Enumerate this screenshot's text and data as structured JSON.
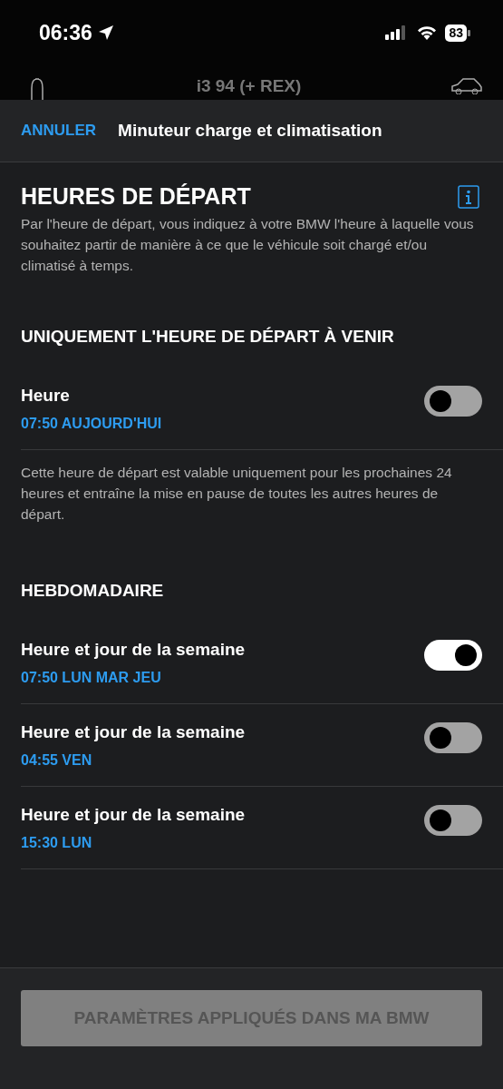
{
  "status_bar": {
    "time": "06:36",
    "battery": "83"
  },
  "background_header": {
    "title": "i3 94 (+ REX)"
  },
  "nav": {
    "cancel": "ANNULER",
    "title": "Minuteur charge et climatisation"
  },
  "intro": {
    "heading": "HEURES DE DÉPART",
    "description": "Par l'heure de départ, vous indiquez à votre BMW l'heure à laquelle vous souhaitez partir de manière à ce que le véhicule soit chargé et/ou climatisé à temps."
  },
  "sections": [
    {
      "title": "UNIQUEMENT L'HEURE DE DÉPART À VENIR",
      "rows": [
        {
          "label": "Heure",
          "value": "07:50 AUJOURD'HUI",
          "on": false
        }
      ],
      "note": "Cette heure de départ est valable uniquement pour les prochaines 24 heures et entraîne la mise en pause de toutes les autres heures de départ."
    },
    {
      "title": "HEBDOMADAIRE",
      "rows": [
        {
          "label": "Heure et jour de la semaine",
          "value": "07:50 LUN MAR JEU",
          "on": true
        },
        {
          "label": "Heure et jour de la semaine",
          "value": "04:55 VEN",
          "on": false
        },
        {
          "label": "Heure et jour de la semaine",
          "value": "15:30 LUN",
          "on": false
        }
      ]
    }
  ],
  "apply_button": {
    "label": "PARAMÈTRES APPLIQUÉS DANS MA BMW",
    "disabled": true
  }
}
